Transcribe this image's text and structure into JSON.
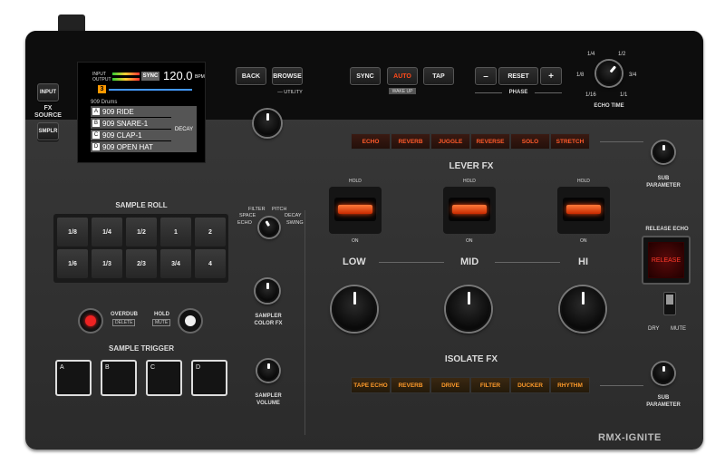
{
  "brand": "RMX-IGNITE",
  "fx_source": {
    "label": "FX\nSOURCE",
    "input": "INPUT",
    "sampler": "SMPLR"
  },
  "screen": {
    "input": "INPUT",
    "output": "OUTPUT",
    "sync": "SYNC",
    "bpm": "120.0",
    "bpm_unit": "BPM",
    "bank_number": "3",
    "bank_name": "909 Drums",
    "items": [
      {
        "key": "A",
        "name": "909 RIDE"
      },
      {
        "key": "B",
        "name": "909 SNARE-1"
      },
      {
        "key": "C",
        "name": "909 CLAP-1"
      },
      {
        "key": "D",
        "name": "909 OPEN HAT"
      }
    ],
    "param": "DECAY"
  },
  "nav": {
    "back": "BACK",
    "browse": "BROWSE",
    "utility": "— UTILITY"
  },
  "tempo": {
    "sync": "SYNC",
    "auto": "AUTO",
    "tap": "TAP",
    "wake_up": "WAKE UP"
  },
  "phase": {
    "minus": "–",
    "reset": "RESET",
    "plus": "+",
    "label": "PHASE"
  },
  "echo_time": {
    "label": "ECHO TIME",
    "marks": [
      "1/4",
      "1/2",
      "1/8",
      "3/4",
      "1/16",
      "1/1"
    ]
  },
  "lever_fx": {
    "title": "LEVER FX",
    "buttons": [
      "ECHO",
      "REVERB",
      "JUGGLE",
      "REVERSE",
      "SOLO",
      "STRETCH"
    ],
    "hold": "HOLD",
    "on": "ON"
  },
  "sub_parameter": "SUB\nPARAMETER",
  "sample_roll": {
    "title": "SAMPLE ROLL",
    "pads": [
      "1/8",
      "1/4",
      "1/2",
      "1",
      "2",
      "1/6",
      "1/3",
      "2/3",
      "3/4",
      "4"
    ]
  },
  "sampler_fx": {
    "options": [
      "FILTER",
      "PITCH",
      "SPACE",
      "DECAY",
      "ECHO",
      "SWING"
    ],
    "color_label": "SAMPLER\nCOLOR FX",
    "volume_label": "SAMPLER\nVOLUME"
  },
  "overdub": {
    "label": "OVERDUB",
    "sub": "DELETE"
  },
  "hold": {
    "label": "HOLD",
    "sub": "MUTE"
  },
  "sample_trigger": {
    "title": "SAMPLE TRIGGER",
    "pads": [
      "A",
      "B",
      "C",
      "D"
    ]
  },
  "isolator": {
    "low": "LOW",
    "mid": "MID",
    "hi": "HI"
  },
  "isolate_fx": {
    "title": "ISOLATE FX",
    "buttons": [
      "TAPE ECHO",
      "REVERB",
      "DRIVE",
      "FILTER",
      "DUCKER",
      "RHYTHM"
    ]
  },
  "release_echo": {
    "title": "RELEASE ECHO",
    "button": "RELEASE",
    "dry": "DRY",
    "mute": "MUTE"
  },
  "colors": {
    "accent_red": "#ff4a1a",
    "accent_orange": "#ff9b2a"
  }
}
